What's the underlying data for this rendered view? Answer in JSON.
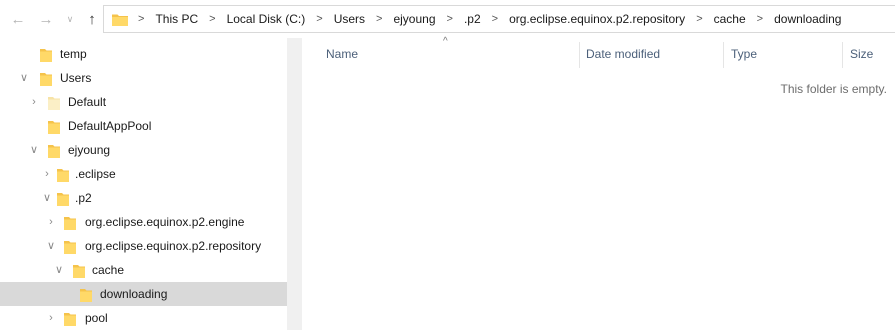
{
  "window": {
    "nav": {
      "back": "←",
      "forward": "→",
      "recent": "∨",
      "up": "↑"
    }
  },
  "address": {
    "crumbs": [
      "This PC",
      "Local Disk (C:)",
      "Users",
      "ejyoung",
      ".p2",
      "org.eclipse.equinox.p2.repository",
      "cache",
      "downloading"
    ],
    "separator": ">"
  },
  "tree": {
    "items": [
      {
        "label": "temp",
        "expand": ""
      },
      {
        "label": "Users",
        "expand": "v"
      },
      {
        "label": "Default",
        "expand": ">"
      },
      {
        "label": "DefaultAppPool",
        "expand": ""
      },
      {
        "label": "ejyoung",
        "expand": "v"
      },
      {
        "label": ".eclipse",
        "expand": ">"
      },
      {
        "label": ".p2",
        "expand": "v"
      },
      {
        "label": "org.eclipse.equinox.p2.engine",
        "expand": ">"
      },
      {
        "label": "org.eclipse.equinox.p2.repository",
        "expand": "v"
      },
      {
        "label": "cache",
        "expand": "v"
      },
      {
        "label": "downloading",
        "expand": "",
        "selected": true
      },
      {
        "label": "pool",
        "expand": ">"
      }
    ]
  },
  "content": {
    "sort_indicator": "^",
    "columns": [
      {
        "label": "Name"
      },
      {
        "label": "Date modified"
      },
      {
        "label": "Type"
      },
      {
        "label": "Size"
      }
    ],
    "empty_message": "This folder is empty."
  },
  "colors": {
    "folder_fill": "#ffd968",
    "folder_back": "#f5c34b",
    "selected_row": "#d9d9d9",
    "header_text": "#4c607a"
  },
  "icons": {
    "folder": "folder-icon",
    "chevron_right": "chevron-right-icon",
    "chevron_down": "chevron-down-icon"
  }
}
